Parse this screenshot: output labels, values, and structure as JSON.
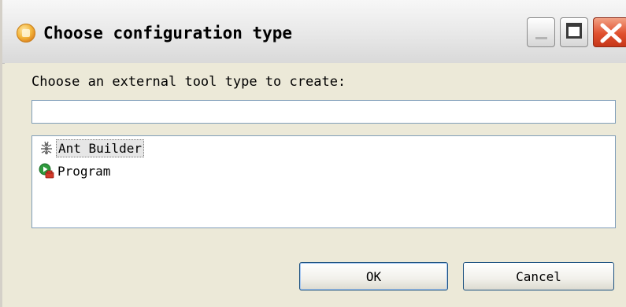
{
  "window": {
    "title": "Choose configuration type",
    "icon": "eclipse-app-icon",
    "controls": [
      "minimize-icon",
      "maximize-icon",
      "close-icon"
    ]
  },
  "dialog": {
    "prompt": "Choose an external tool type to create:",
    "filter": {
      "value": "",
      "placeholder": ""
    },
    "items": [
      {
        "label": "Ant Builder",
        "icon": "ant-icon",
        "selected": true
      },
      {
        "label": "Program",
        "icon": "program-launch-icon",
        "selected": false
      }
    ],
    "buttons": {
      "ok": "OK",
      "cancel": "Cancel"
    }
  },
  "colors": {
    "background": "#ece9d8",
    "input_border": "#7f9db9",
    "close_button": "#e0512f",
    "selection": "#e6e6e6"
  }
}
